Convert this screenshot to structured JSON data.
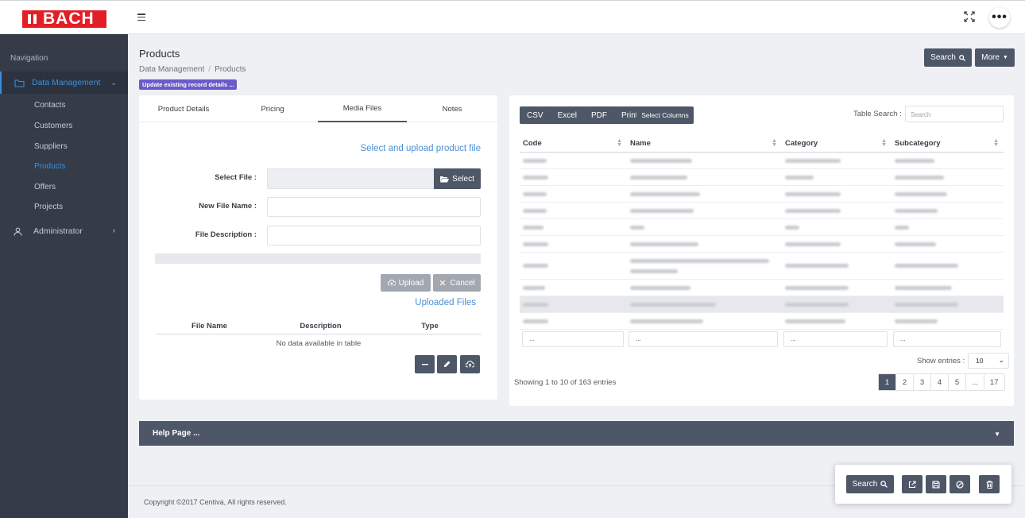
{
  "brand": {
    "logo_text": "BACH",
    "color": "#e31e24"
  },
  "sidebar": {
    "title": "Navigation",
    "data_management": "Data Management",
    "items": [
      "Contacts",
      "Customers",
      "Suppliers",
      "Products",
      "Offers",
      "Projects"
    ],
    "active_item": "Products",
    "administrator": "Administrator"
  },
  "page": {
    "title": "Products",
    "breadcrumb": [
      "Data Management",
      "Products"
    ],
    "badge": "Update existing record details ...",
    "search_button": "Search",
    "more_button": "More"
  },
  "tabs": [
    "Product Details",
    "Pricing",
    "Media Files",
    "Notes"
  ],
  "active_tab": "Media Files",
  "media": {
    "heading": "Select and upload product file",
    "select_file_label": "Select File :",
    "select_button": "Select",
    "new_file_name_label": "New File Name :",
    "file_description_label": "File Description :",
    "upload_button": "Upload",
    "cancel_button": "Cancel",
    "uploaded_heading": "Uploaded Files",
    "table_headers": [
      "File Name",
      "Description",
      "Type"
    ],
    "empty_text": "No data available in table"
  },
  "grid": {
    "export_buttons": [
      "CSV",
      "Excel",
      "PDF",
      "Print"
    ],
    "select_columns": "Select Columns",
    "table_search_label": "Table Search :",
    "table_search_placeholder": "Search",
    "columns": [
      "Code",
      "Name",
      "Category",
      "Subcategory"
    ],
    "filter_placeholder": "...",
    "show_entries_label": "Show entries :",
    "show_entries_value": "10",
    "showing_text": "Showing 1 to 10 of 163 entries",
    "pages": [
      "1",
      "2",
      "3",
      "4",
      "5",
      "...",
      "17"
    ],
    "active_page": "1"
  },
  "help": {
    "label": "Help Page ..."
  },
  "footer": {
    "copyright": "Copyright ©2017 Centiva, All rights reserved."
  },
  "float_bar": {
    "search_button": "Search"
  }
}
